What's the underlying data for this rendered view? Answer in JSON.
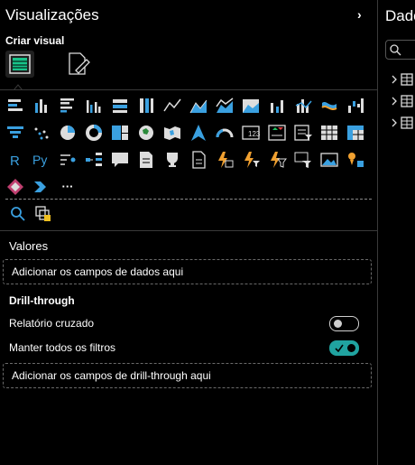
{
  "visualizations": {
    "title": "Visualizações",
    "expand_glyph": "›",
    "build_label": "Criar visual",
    "more_glyph": "···",
    "fields": {
      "values_label": "Valores",
      "values_placeholder": "Adicionar os campos de dados aqui"
    },
    "drillthrough": {
      "title": "Drill-through",
      "cross_report_label": "Relatório cruzado",
      "cross_report_on": false,
      "keep_filters_label": "Manter todos os filtros",
      "keep_filters_on": true,
      "placeholder": "Adicionar os campos de drill-through aqui"
    },
    "colors": {
      "accent": "#20a3a0",
      "icon_blue": "#3aa0e0",
      "icon_orange": "#f0a030"
    }
  },
  "data_pane": {
    "title": "Dados"
  }
}
